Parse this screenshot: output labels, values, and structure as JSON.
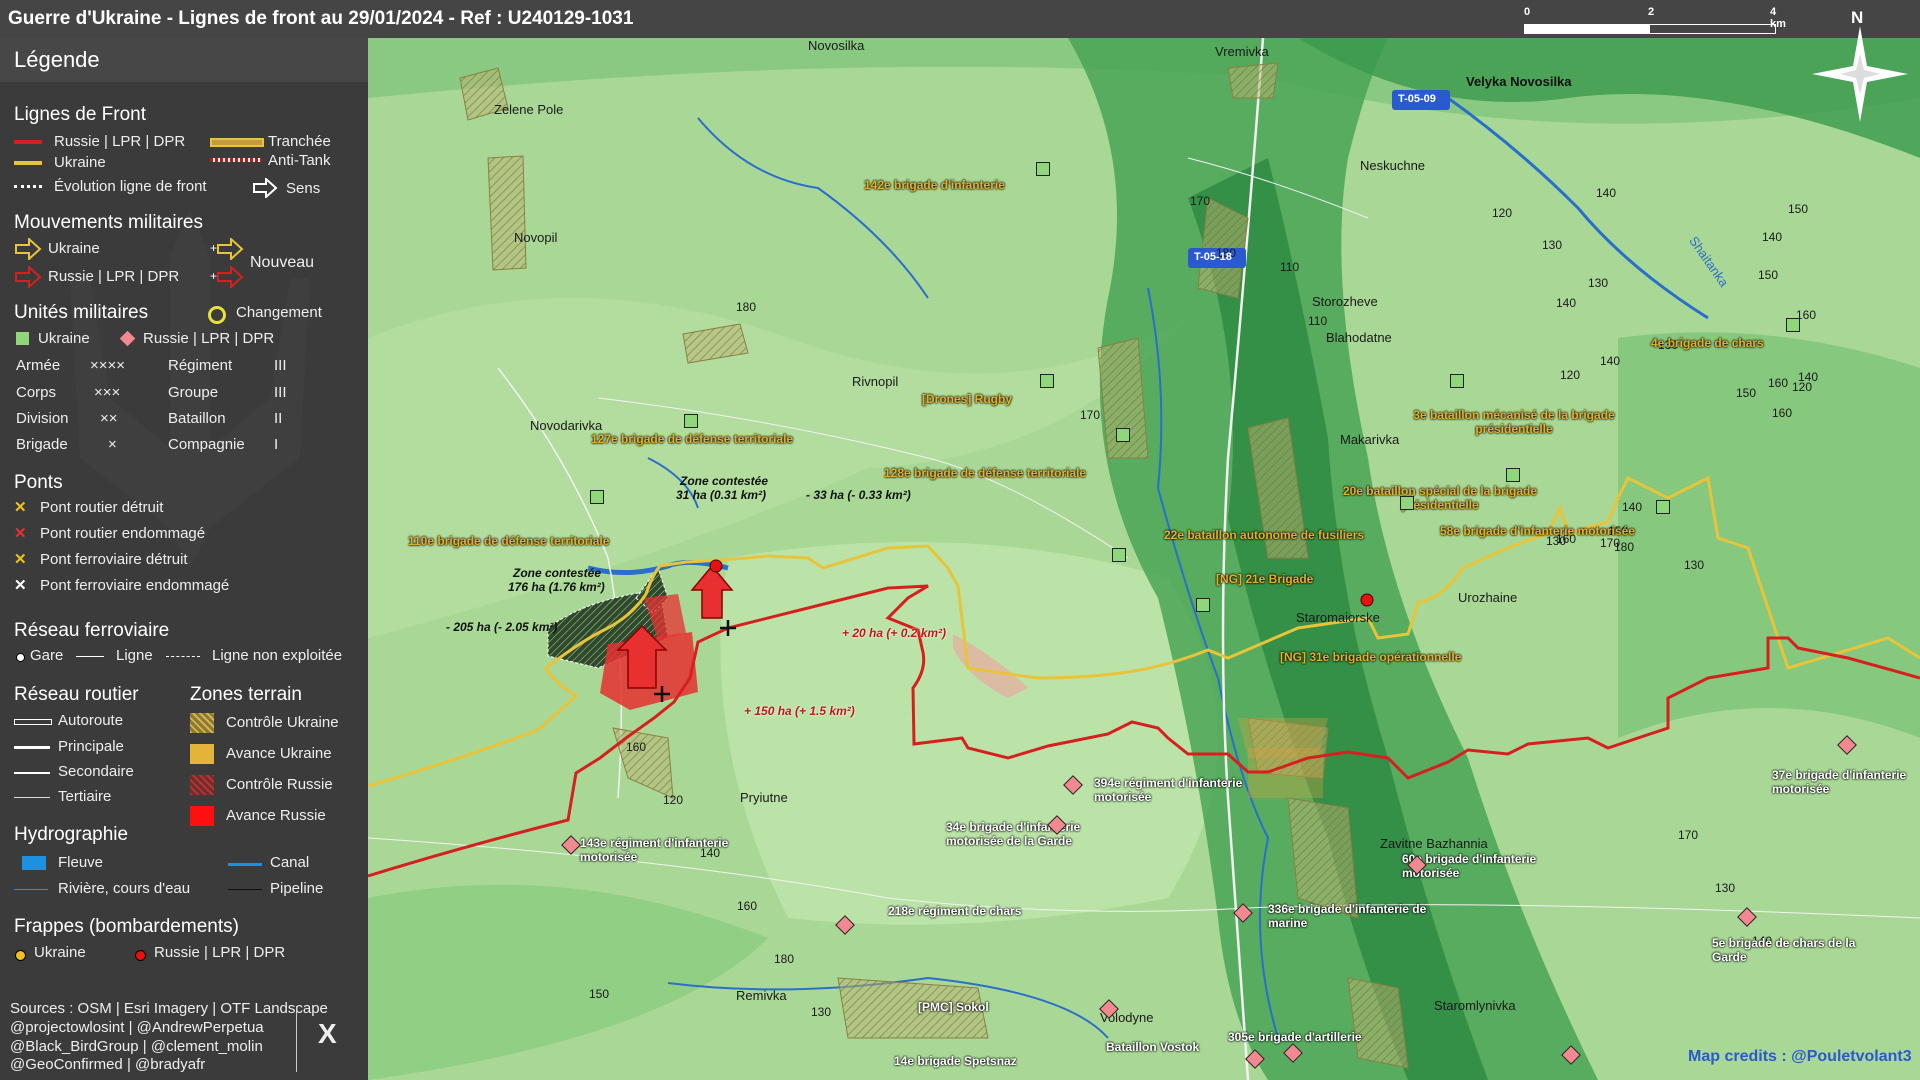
{
  "title": "Guerre d'Ukraine - Lignes de front au 29/01/2024 - Ref : U240129-1031",
  "legend": {
    "heading": "Légende",
    "front_lines": {
      "title": "Lignes de Front",
      "russia": "Russie | LPR | DPR",
      "ukraine": "Ukraine",
      "trench": "Tranchée",
      "antitank": "Anti-Tank",
      "evolution": "Évolution ligne de front",
      "direction": "Sens"
    },
    "movements": {
      "title": "Mouvements militaires",
      "ukraine": "Ukraine",
      "russia": "Russie | LPR | DPR",
      "new": "Nouveau"
    },
    "units": {
      "title": "Unités militaires",
      "change": "Changement",
      "ukraine": "Ukraine",
      "russia": "Russie | LPR | DPR",
      "rows": [
        {
          "a": "Armée",
          "as": "××××",
          "b": "Régiment",
          "bs": "III"
        },
        {
          "a": "Corps",
          "as": "×××",
          "b": "Groupe",
          "bs": "III"
        },
        {
          "a": "Division",
          "as": "××",
          "b": "Bataillon",
          "bs": "II"
        },
        {
          "a": "Brigade",
          "as": "×",
          "b": "Compagnie",
          "bs": "I"
        }
      ]
    },
    "bridges": {
      "title": "Ponts",
      "items": [
        "Pont routier détruit",
        "Pont routier endommagé",
        "Pont ferroviaire détruit",
        "Pont ferroviaire endommagé"
      ]
    },
    "rail": {
      "title": "Réseau ferroviaire",
      "station": "Gare",
      "line": "Ligne",
      "unused": "Ligne non exploitée"
    },
    "roads": {
      "title": "Réseau routier",
      "items": [
        "Autoroute",
        "Principale",
        "Secondaire",
        "Tertiaire"
      ]
    },
    "zones": {
      "title": "Zones terrain",
      "items": [
        "Contrôle Ukraine",
        "Avance Ukraine",
        "Contrôle Russie",
        "Avance Russie"
      ]
    },
    "hydro": {
      "title": "Hydrographie",
      "river_big": "Fleuve",
      "canal": "Canal",
      "river": "Rivière, cours d'eau",
      "pipeline": "Pipeline"
    },
    "strikes": {
      "title": "Frappes (bombardements)",
      "ukraine": "Ukraine",
      "russia": "Russie | LPR | DPR"
    },
    "sources": [
      "Sources : OSM | Esri Imagery | OTF Landscape",
      "@projectowlosint | @AndrewPerpetua",
      "@Black_BirdGroup | @clement_molin",
      "@GeoConfirmed | @bradyafr"
    ],
    "x_logo": "X"
  },
  "colors": {
    "russia": "#d62020",
    "ukraine": "#e8c43a",
    "land_light": "#9fd48a",
    "land_dark": "#3d9a4e",
    "panel": "#3b3b3b"
  },
  "scale": {
    "ticks": [
      "0",
      "2",
      "4 km"
    ]
  },
  "compass": "N",
  "credits": "Map credits : @Pouletvolant3",
  "places": [
    "Novosilka",
    "Vremivka",
    "Velyka Novosilka",
    "Zelene Pole",
    "Neskuchne",
    "Novopil",
    "Storozheve",
    "Blahodatne",
    "Rivnopil",
    "Novodarivka",
    "Makarivka",
    "Staromaiorske",
    "Urozhaine",
    "Pryiutne",
    "Zavitne Bazhannia",
    "Remivka",
    "Volodyne",
    "Staromlynivka",
    "Shaitanka"
  ],
  "road_badges": [
    "T-05-09",
    "T-05-18"
  ],
  "elevations": [
    "170",
    "180",
    "110",
    "120",
    "130",
    "140",
    "110",
    "180",
    "170",
    "130",
    "140",
    "120",
    "140",
    "130",
    "150",
    "140",
    "150",
    "160",
    "170",
    "160",
    "130",
    "140",
    "150",
    "160",
    "180",
    "140",
    "150",
    "130",
    "120",
    "160",
    "170",
    "130",
    "140",
    "150",
    "160",
    "120",
    "140",
    "160",
    "180",
    "130"
  ],
  "units_ua": [
    "142e brigade d'infanterie",
    "[Drones] Rugby",
    "127e brigade de défense territoriale",
    "128e brigade de défense territoriale",
    "110e brigade de défense territoriale",
    "4e brigade de chars",
    "3e bataillon mécanisé de la brigade présidentielle",
    "20e bataillon spécial de la brigade présidentielle",
    "22e bataillon autonome de fusiliers",
    "58e brigade d'infanterie motorisée",
    "[NG] 21e Brigade",
    "[NG] 31e brigade opérationnelle"
  ],
  "units_ru": [
    "394e régiment d'infanterie motorisée",
    "34e brigade d'infanterie motorisée de la Garde",
    "143e régiment d'infanterie motorisée",
    "218e régiment de chars",
    "60e brigade d'infanterie motorisée",
    "336e brigade d'infanterie de marine",
    "5e brigade de chars de la Garde",
    "37e brigade d'infanterie motorisée",
    "[PMC] Sokol",
    "Bataillon Vostok",
    "14e brigade Spetsnaz",
    "305e brigade d'artillerie"
  ],
  "annotations": {
    "contested1_title": "Zone contestée",
    "contested1_val": "31 ha (0.31 km²)",
    "contested2_title": "Zone contestée",
    "contested2_val": "176 ha (1.76 km²)",
    "ua_loss1": "- 33 ha (- 0.33 km²)",
    "ua_loss2": "- 205 ha (- 2.05 km²)",
    "ru_gain1": "+ 20 ha (+ 0.2 km²)",
    "ru_gain2": "+ 150 ha (+ 1.5 km²)"
  }
}
